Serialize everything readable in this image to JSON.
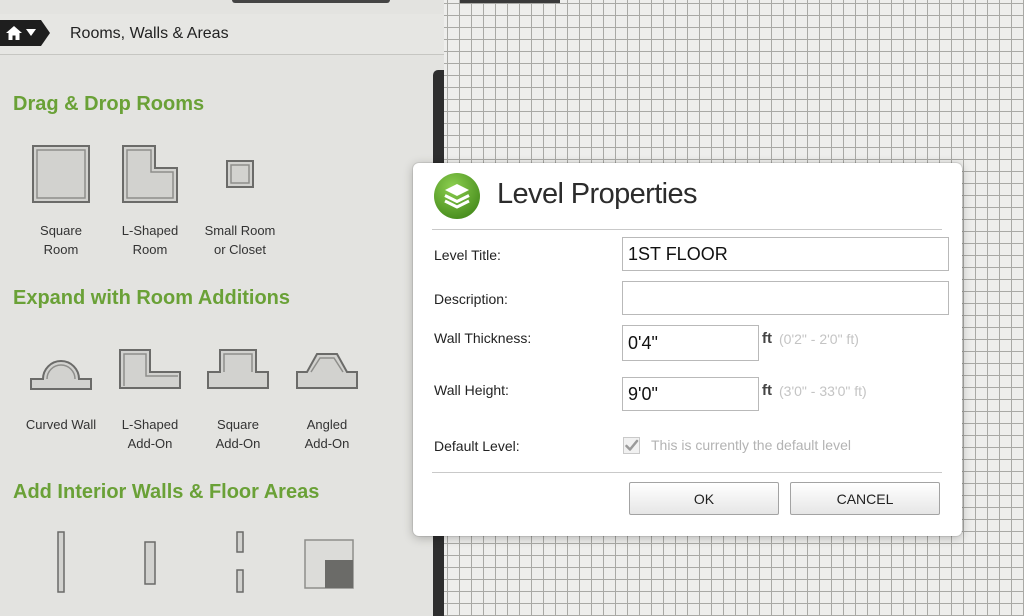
{
  "breadcrumb": {
    "title": "Rooms, Walls & Areas"
  },
  "sections": {
    "rooms": {
      "title": "Drag & Drop Rooms",
      "items": [
        {
          "line1": "Square",
          "line2": "Room"
        },
        {
          "line1": "L-Shaped",
          "line2": "Room"
        },
        {
          "line1": "Small Room",
          "line2": "or Closet"
        }
      ]
    },
    "additions": {
      "title": "Expand with Room Additions",
      "items": [
        {
          "line1": "Curved Wall",
          "line2": ""
        },
        {
          "line1": "L-Shaped",
          "line2": "Add-On"
        },
        {
          "line1": "Square",
          "line2": "Add-On"
        },
        {
          "line1": "Angled",
          "line2": "Add-On"
        }
      ]
    },
    "interior": {
      "title": "Add Interior Walls & Floor Areas"
    }
  },
  "dialog": {
    "title": "Level Properties",
    "level_title_label": "Level Title:",
    "level_title_value": "1ST FLOOR",
    "description_label": "Description:",
    "description_value": "",
    "wall_thickness_label": "Wall Thickness:",
    "wall_thickness_value": "0'4\"",
    "wall_thickness_unit": "ft",
    "wall_thickness_range": "(0'2\" - 2'0\" ft)",
    "wall_height_label": "Wall Height:",
    "wall_height_value": "9'0\"",
    "wall_height_unit": "ft",
    "wall_height_range": "(3'0\" - 33'0\" ft)",
    "default_level_label": "Default Level:",
    "default_level_note": "This is currently the default level",
    "default_level_checked": true,
    "ok_label": "OK",
    "cancel_label": "CANCEL",
    "icon": "layers-icon"
  },
  "colors": {
    "section_title": "#6aa137",
    "dialog_icon": "#5fa82e",
    "range_text": "#c4c4c4"
  }
}
